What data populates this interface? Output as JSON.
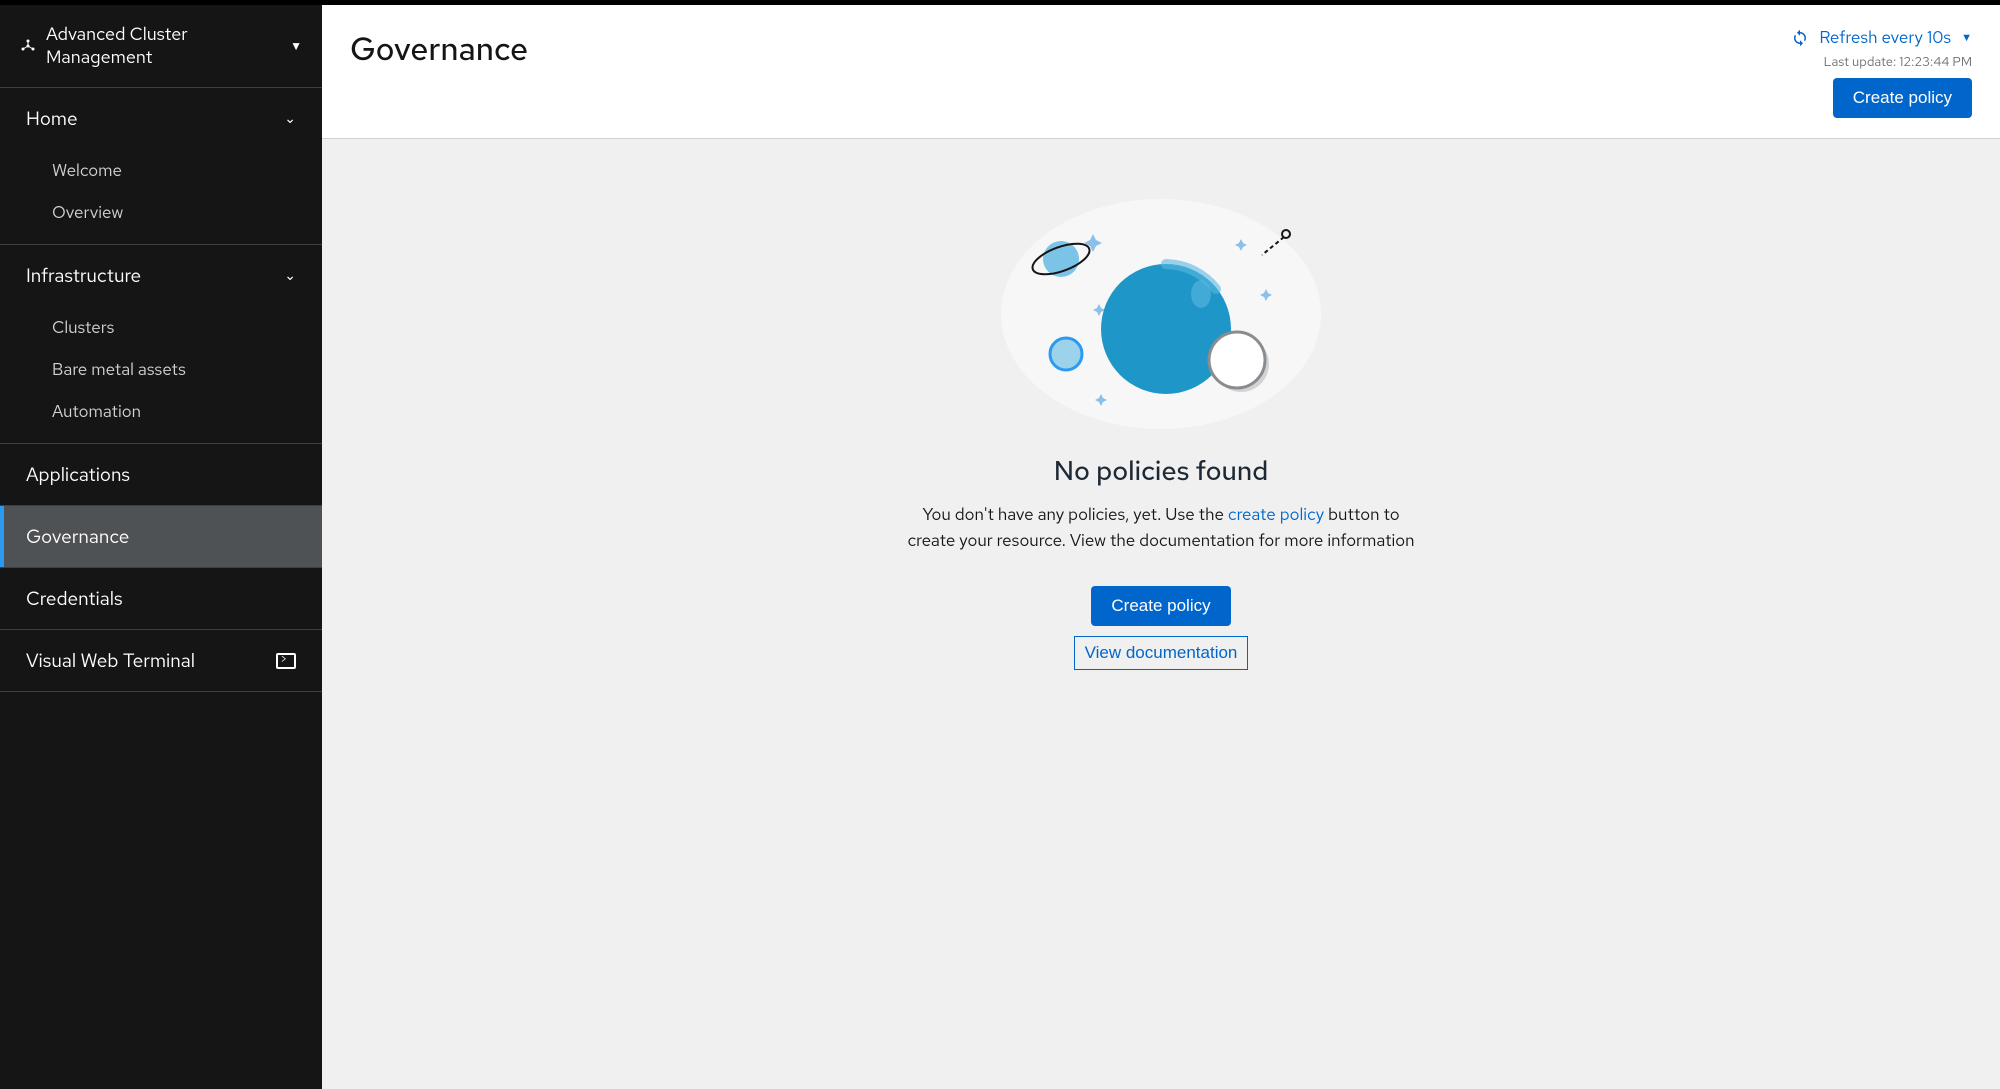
{
  "appSwitcher": {
    "label": "Advanced Cluster Management"
  },
  "sidebar": {
    "home": {
      "label": "Home",
      "items": [
        {
          "label": "Welcome"
        },
        {
          "label": "Overview"
        }
      ]
    },
    "infrastructure": {
      "label": "Infrastructure",
      "items": [
        {
          "label": "Clusters"
        },
        {
          "label": "Bare metal assets"
        },
        {
          "label": "Automation"
        }
      ]
    },
    "applications": {
      "label": "Applications"
    },
    "governance": {
      "label": "Governance"
    },
    "credentials": {
      "label": "Credentials"
    },
    "vwt": {
      "label": "Visual Web Terminal"
    }
  },
  "header": {
    "title": "Governance",
    "refresh_label": "Refresh every 10s",
    "last_update": "Last update: 12:23:44 PM",
    "create_button": "Create policy"
  },
  "empty": {
    "title": "No policies found",
    "desc_before": "You don't have any policies, yet. Use the ",
    "desc_link": "create policy",
    "desc_after": " button to create your resource. View the documentation for more information",
    "create_button": "Create policy",
    "docs_button": "View documentation"
  },
  "colors": {
    "accent": "#0066cc",
    "sidebar_bg": "#151515",
    "active_bg": "#4f5255",
    "active_border": "#2b9af3",
    "main_bg": "#f0f0f0"
  }
}
